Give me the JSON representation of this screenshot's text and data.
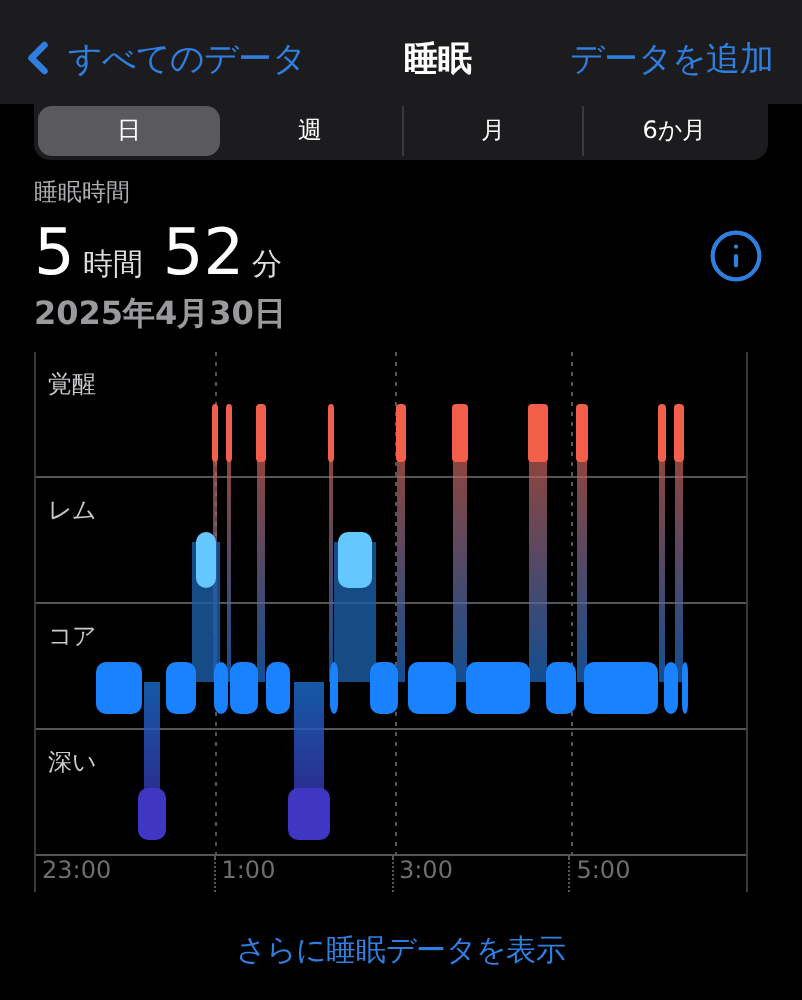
{
  "nav": {
    "back": "すべてのデータ",
    "title": "睡眠",
    "action": "データを追加"
  },
  "tabs": [
    {
      "label": "日",
      "selected": true
    },
    {
      "label": "週",
      "selected": false
    },
    {
      "label": "月",
      "selected": false
    },
    {
      "label": "6か月",
      "selected": false
    }
  ],
  "summary": {
    "label": "睡眠時間",
    "hours": "5",
    "hours_unit": "時間",
    "minutes": "52",
    "minutes_unit": "分",
    "date": "2025年4月30日"
  },
  "chart": {
    "stages": [
      "覚醒",
      "レム",
      "コア",
      "深い"
    ],
    "times": [
      "23:00",
      "1:00",
      "3:00",
      "5:00"
    ]
  },
  "more_link": "さらに睡眠データを表示"
}
